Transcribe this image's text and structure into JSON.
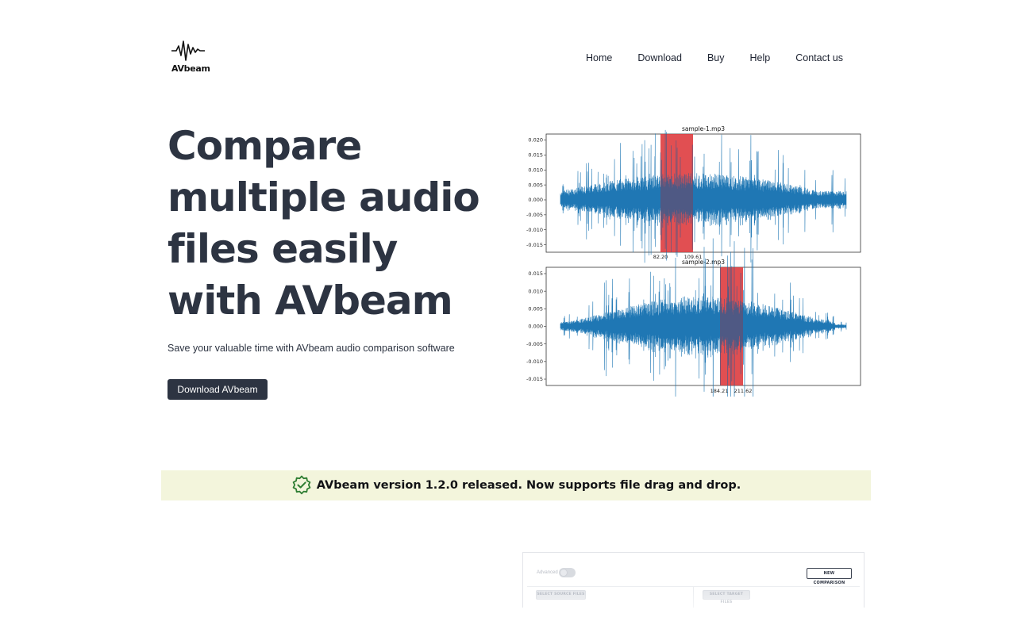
{
  "brand": {
    "name": "AVbeam",
    "logo_icon": "waveform-logo-icon"
  },
  "nav": {
    "items": [
      "Home",
      "Download",
      "Buy",
      "Help",
      "Contact us"
    ]
  },
  "hero": {
    "title": "Compare multiple audio files easily with AVbeam",
    "subtitle": "Save your valuable time with AVbeam audio comparison software",
    "cta_label": "Download AVbeam"
  },
  "banner": {
    "icon": "verified-badge-icon",
    "text": "AVbeam version 1.2.0 released. Now supports file drag and drop.",
    "background": "#f3f5dc",
    "icon_color": "#2e7d32"
  },
  "plots": [
    {
      "title": "sample-1.mp3",
      "yticks": [
        "0.020",
        "0.015",
        "0.010",
        "0.005",
        "0.000",
        "-0.005",
        "-0.010",
        "-0.015"
      ],
      "ylim": [
        -0.0175,
        0.022
      ],
      "highlight": {
        "start_label": "82.20",
        "end_label": "109.61"
      },
      "wave_color": "#1f77b4",
      "highlight_color": "#ff4d4d"
    },
    {
      "title": "sample-2.mp3",
      "yticks": [
        "0.015",
        "0.010",
        "0.005",
        "0.000",
        "-0.005",
        "-0.010",
        "-0.015"
      ],
      "ylim": [
        -0.0168,
        0.0168
      ],
      "highlight": {
        "start_label": "184.21",
        "end_label": "211.62"
      },
      "wave_color": "#1f77b4",
      "highlight_color": "#ff4d4d"
    }
  ],
  "app_preview": {
    "advanced_label": "Advanced",
    "new_comparison_label": "NEW COMPARISON",
    "select_source_label": "SELECT SOURCE FILES",
    "select_target_label": "SELECT TARGET FILES"
  }
}
